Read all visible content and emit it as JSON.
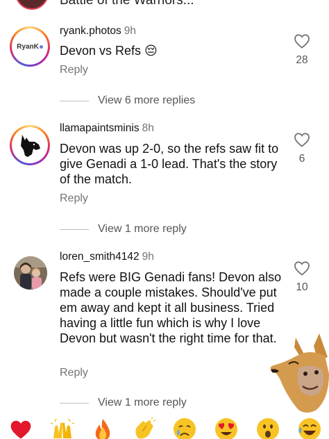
{
  "top_partial": {
    "text": "Battle of the Warriors..."
  },
  "comments": [
    {
      "username": "ryank.photos",
      "time": "9h",
      "text": "Devon vs Refs 😔",
      "reply": "Reply",
      "likes": "28",
      "avatar_text": "RyanK"
    },
    {
      "username": "llamapaintsminis",
      "time": "8h",
      "text": "Devon was up 2-0, so the refs saw fit to give Genadi a 1-0 lead. That's the story of the match.",
      "reply": "Reply",
      "likes": "6"
    },
    {
      "username": "loren_smith4142",
      "time": "9h",
      "text": "Refs were BIG Genadi fans! Devon also made a couple mistakes. Should've put em away and kept it all business. Tried having a little fun which is why I love Devon but wasn't the right time for that.",
      "reply": "Reply",
      "likes": "10"
    }
  ],
  "view_more": [
    "View 6 more replies",
    "View 1 more reply",
    "View 1 more reply"
  ],
  "emoji_bar": [
    "heart",
    "raised-hands",
    "fire",
    "clapping-hands",
    "crying-face",
    "heart-eyes",
    "surprised-face",
    "laughing-face"
  ],
  "colors": {
    "secondary_text": "#737373",
    "like_heart": "#737373"
  }
}
